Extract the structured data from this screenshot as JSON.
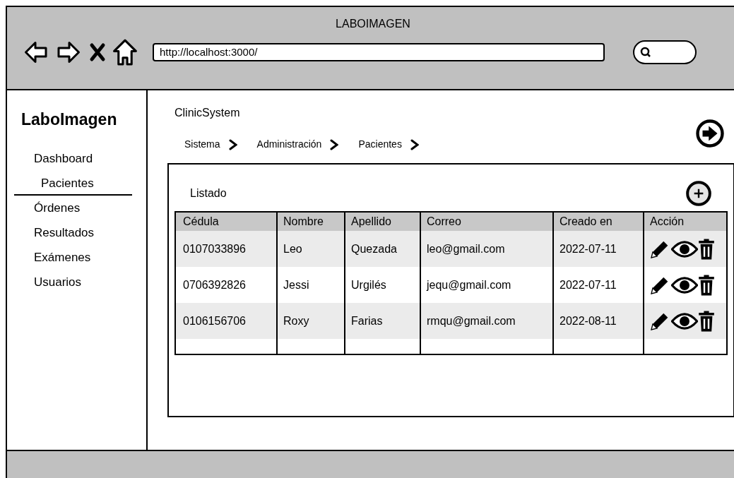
{
  "browser": {
    "title": "LABOIMAGEN",
    "url": "http://localhost:3000/"
  },
  "sidebar": {
    "brand": "LaboImagen",
    "items": [
      {
        "label": "Dashboard",
        "selected": false
      },
      {
        "label": "Pacientes",
        "selected": true
      },
      {
        "label": "Órdenes",
        "selected": false
      },
      {
        "label": "Resultados",
        "selected": false
      },
      {
        "label": "Exámenes",
        "selected": false
      },
      {
        "label": "Usuarios",
        "selected": false
      }
    ]
  },
  "header": {
    "title": "ClinicSystem"
  },
  "breadcrumb": [
    "Sistema",
    "Administración",
    "Pacientes"
  ],
  "panel": {
    "title": "Listado"
  },
  "table": {
    "columns": [
      "Cédula",
      "Nombre",
      "Apellido",
      "Correo",
      "Creado en",
      "Acción"
    ],
    "rows": [
      [
        "0107033896",
        "Leo",
        "Quezada",
        "leo@gmail.com",
        "2022-07-11"
      ],
      [
        "0706392826",
        "Jessi",
        "Urgilés",
        "jequ@gmail.com",
        "2022-07-11"
      ],
      [
        "0106156706",
        "Roxy",
        "Farias",
        "rmqu@gmail.com",
        "2022-08-11"
      ]
    ]
  }
}
